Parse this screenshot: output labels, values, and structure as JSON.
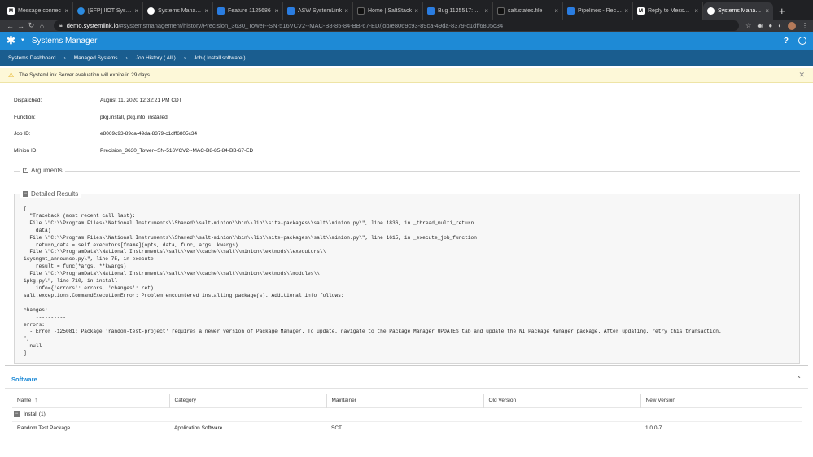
{
  "browser": {
    "tabs": [
      {
        "label": "Message connec",
        "icon": "m-icon",
        "active": false
      },
      {
        "label": "[SFP] IIOT Syster",
        "icon": "cloud-icon",
        "active": false
      },
      {
        "label": "Systems Manager",
        "icon": "github-icon",
        "active": false
      },
      {
        "label": "Feature 1125686",
        "icon": "azure-icon",
        "active": false
      },
      {
        "label": "ASW SystemLink",
        "icon": "azure-icon",
        "active": false
      },
      {
        "label": "Home | SaltStack",
        "icon": "salt-icon",
        "active": false
      },
      {
        "label": "Bug 1125517: Err",
        "icon": "azure-icon",
        "active": false
      },
      {
        "label": "salt.states.file",
        "icon": "salt-icon",
        "active": false
      },
      {
        "label": "Pipelines - Recent",
        "icon": "azure-icon",
        "active": false
      },
      {
        "label": "Reply to Message",
        "icon": "m-icon",
        "active": false
      },
      {
        "label": "Systems Manager",
        "icon": "github-icon",
        "active": true
      }
    ],
    "url_host": "demo.systemlink.io",
    "url_path": "/#systemsmanagement/history/Precision_3630_Tower--SN-516VCV2--MAC-B8-85-84-BB-67-ED/job/e8069c93-89ca-49da-8379-c1dff6805c34"
  },
  "app": {
    "title": "Systems Manager",
    "help": "?",
    "accent": "#1e8ad6"
  },
  "breadcrumbs": [
    "Systems Dashboard",
    "Managed Systems",
    "Job History ( All )",
    "Job ( Install software )"
  ],
  "banner": {
    "text": "The SystemLink Server evaluation will expire in 29 days."
  },
  "job": {
    "dispatched_label": "Dispatched:",
    "dispatched_value": "August 11, 2020 12:32:21 PM CDT",
    "function_label": "Function:",
    "function_value": "pkg.install, pkg.info_installed",
    "jobid_label": "Job ID:",
    "jobid_value": "e8069c93-89ca-49da-8379-c1dff6805c34",
    "minion_label": "Minion ID:",
    "minion_value": "Precision_3630_Tower--SN-516VCV2--MAC-B8-85-84-BB-67-ED"
  },
  "sections": {
    "arguments": "Arguments",
    "results": "Detailed Results"
  },
  "results_text": "[\n  \"Traceback (most recent call last):\n  File \\\"C:\\\\Program Files\\\\National Instruments\\\\Shared\\\\salt-minion\\\\bin\\\\lib\\\\site-packages\\\\salt\\\\minion.py\\\", line 1836, in _thread_multi_return\n    data)\n  File \\\"C:\\\\Program Files\\\\National Instruments\\\\Shared\\\\salt-minion\\\\bin\\\\lib\\\\site-packages\\\\salt\\\\minion.py\\\", line 1615, in _execute_job_function\n    return_data = self.executors[fname](opts, data, func, args, kwargs)\n  File \\\"C:\\\\ProgramData\\\\National Instruments\\\\salt\\\\var\\\\cache\\\\salt\\\\minion\\\\extmods\\\\executors\\\\\nisysmgmt_announce.py\\\", line 75, in execute\n    result = func(*args, **kwargs)\n  File \\\"C:\\\\ProgramData\\\\National Instruments\\\\salt\\\\var\\\\cache\\\\salt\\\\minion\\\\extmods\\\\modules\\\\\nipkg.py\\\", line 710, in install\n    info={'errors': errors, 'changes': ret)\nsalt.exceptions.CommandExecutionError: Problem encountered installing package(s). Additional info follows:\n\nchanges:\n    ----------\nerrors:\n  - Error -125081: Package 'random-test-project' requires a newer version of Package Manager. To update, navigate to the Package Manager UPDATES tab and update the NI Package Manager package. After updating, retry this transaction.\n\",\n  null\n]",
  "software": {
    "title": "Software",
    "columns": [
      "Name",
      "Category",
      "Maintainer",
      "Old Version",
      "New Version"
    ],
    "group_label": "Install (1)",
    "rows": [
      {
        "name": "Random Test Package",
        "category": "Application Software",
        "maintainer": "SCT",
        "old_version": "",
        "new_version": "1.0.0-7"
      }
    ]
  }
}
